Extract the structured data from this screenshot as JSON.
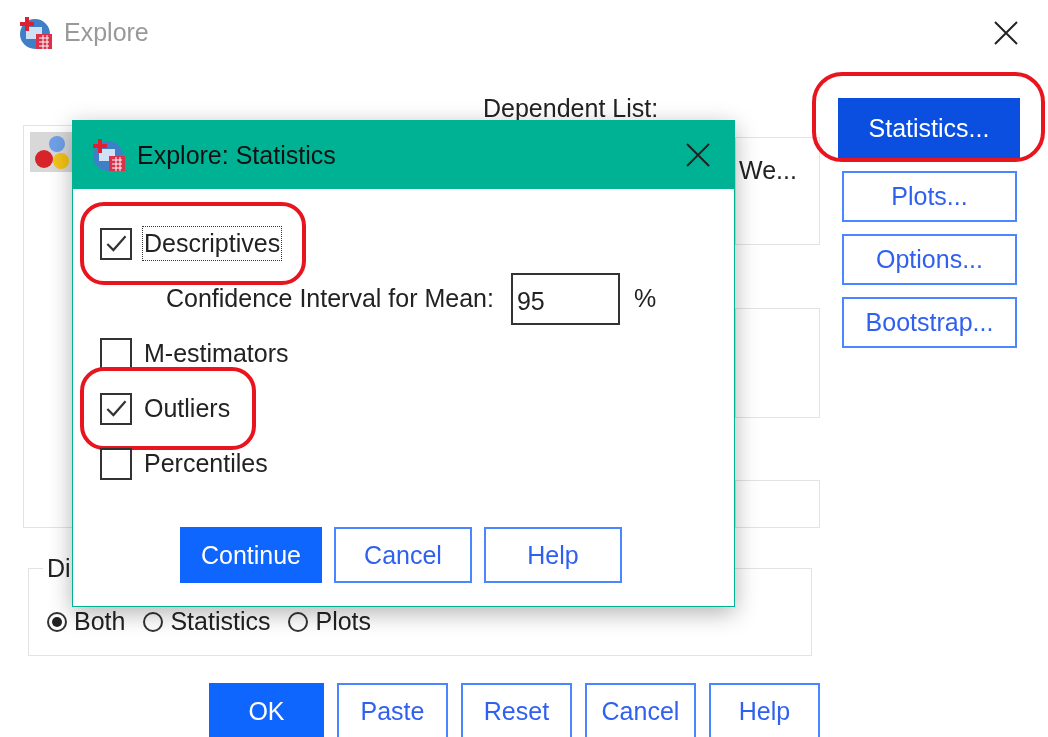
{
  "window": {
    "title": "Explore"
  },
  "dependent_list": {
    "label": "Dependent List:",
    "items": [
      "We..."
    ]
  },
  "side_buttons": [
    {
      "label": "Statistics...",
      "selected": true,
      "highlighted": true
    },
    {
      "label": "Plots...",
      "selected": false,
      "highlighted": false
    },
    {
      "label": "Options...",
      "selected": false,
      "highlighted": false
    },
    {
      "label": "Bootstrap...",
      "selected": false,
      "highlighted": false
    }
  ],
  "display": {
    "legend": "Di",
    "options": [
      {
        "label": "Both",
        "selected": true
      },
      {
        "label": "Statistics",
        "selected": false
      },
      {
        "label": "Plots",
        "selected": false
      }
    ]
  },
  "buttons": [
    {
      "label": "OK",
      "default": true
    },
    {
      "label": "Paste",
      "default": false
    },
    {
      "label": "Reset",
      "default": false
    },
    {
      "label": "Cancel",
      "default": false
    },
    {
      "label": "Help",
      "default": false
    }
  ],
  "dialog": {
    "title": "Explore: Statistics",
    "options": [
      {
        "kind": "checkbox",
        "label": "Descriptives",
        "checked": true,
        "highlighted": true,
        "focused": true
      },
      {
        "kind": "field",
        "label": "Confidence Interval for Mean:",
        "value": "95",
        "unit": "%"
      },
      {
        "kind": "checkbox",
        "label": "M-estimators",
        "checked": false,
        "highlighted": false,
        "focused": false
      },
      {
        "kind": "checkbox",
        "label": "Outliers",
        "checked": true,
        "highlighted": true,
        "focused": false
      },
      {
        "kind": "checkbox",
        "label": "Percentiles",
        "checked": false,
        "highlighted": false,
        "focused": false
      }
    ],
    "buttons": [
      {
        "label": "Continue",
        "default": true
      },
      {
        "label": "Cancel",
        "default": false
      },
      {
        "label": "Help",
        "default": false
      }
    ]
  }
}
